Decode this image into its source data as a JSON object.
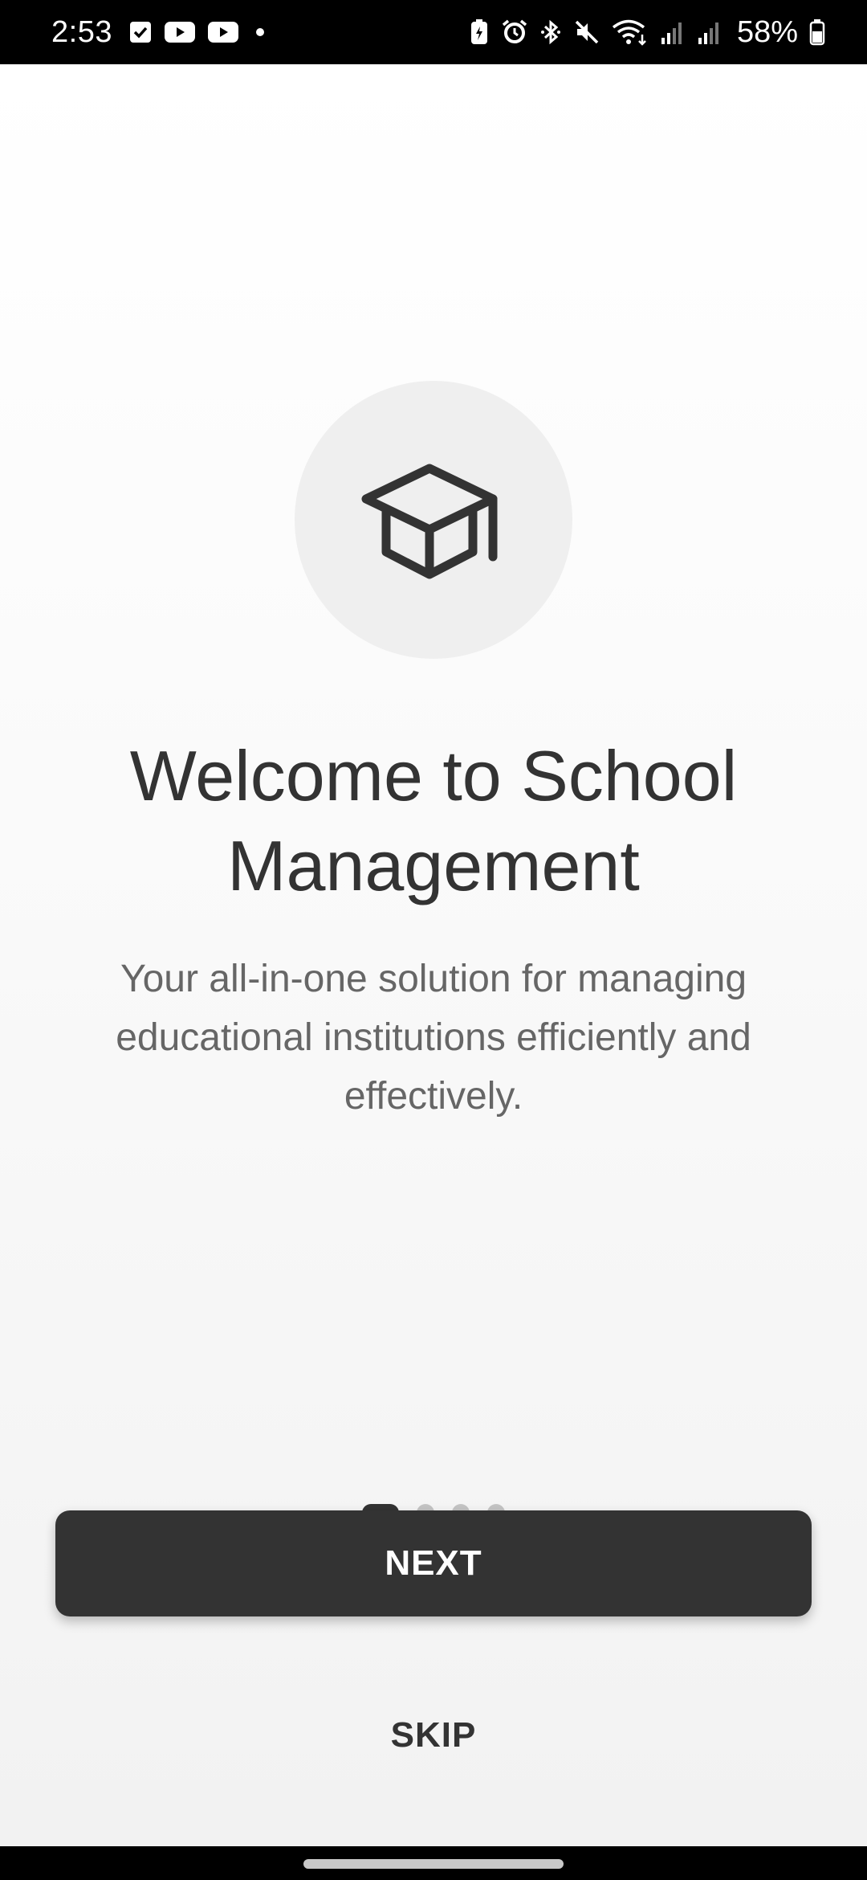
{
  "status_bar": {
    "time": "2:53",
    "battery_percent": "58%",
    "left_icons": [
      "check-notification-icon",
      "youtube-icon",
      "youtube-icon",
      "notification-dot-icon"
    ],
    "right_icons": [
      "battery-saver-icon",
      "alarm-icon",
      "bluetooth-icon",
      "mute-icon",
      "wifi-icon",
      "signal-icon",
      "signal-icon",
      "battery-icon"
    ]
  },
  "hero": {
    "icon": "graduation-cap-icon"
  },
  "onboarding": {
    "title": "Welcome to School Management",
    "subtitle": "Your all-in-one solution for managing educational institutions efficiently and effectively.",
    "page_count": 4,
    "current_page": 1
  },
  "actions": {
    "next_label": "NEXT",
    "skip_label": "SKIP"
  },
  "colors": {
    "primary": "#333333",
    "text_secondary": "#666666",
    "dot_inactive": "#c4c4c4",
    "icon_background": "#efefef"
  }
}
